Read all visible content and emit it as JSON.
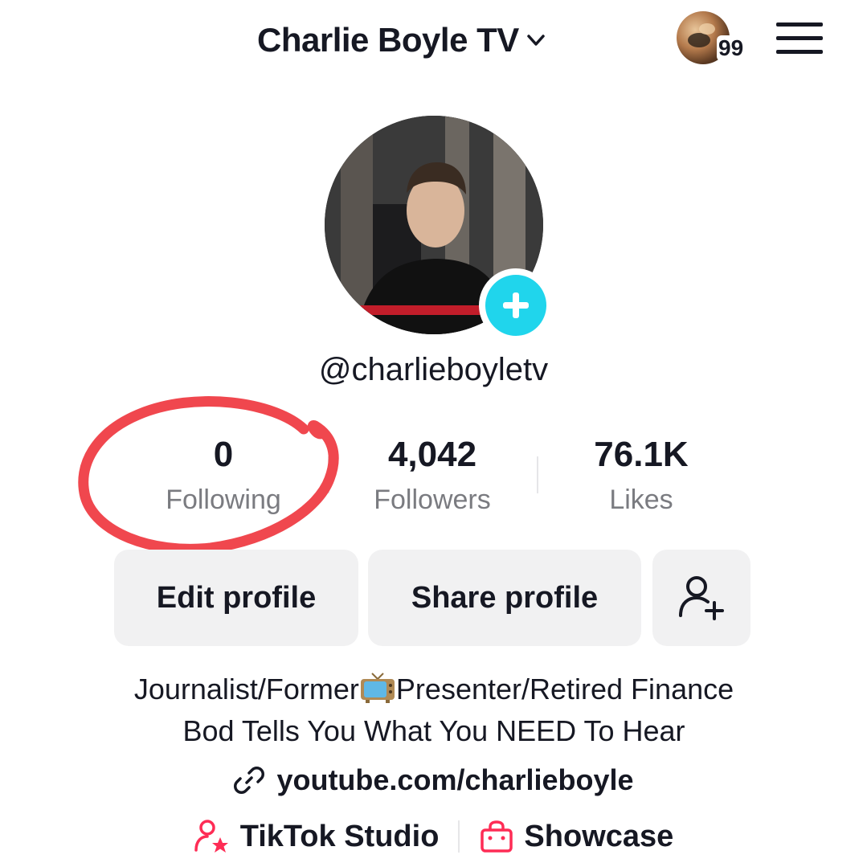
{
  "header": {
    "account_name": "Charlie Boyle TV",
    "notification_count": "99"
  },
  "profile": {
    "username": "@charlieboyletv"
  },
  "stats": [
    {
      "value": "0",
      "label": "Following"
    },
    {
      "value": "4,042",
      "label": "Followers"
    },
    {
      "value": "76.1K",
      "label": "Likes"
    }
  ],
  "actions": {
    "edit_label": "Edit profile",
    "share_label": "Share profile",
    "add_friends_icon": "add-person-icon"
  },
  "bio": {
    "line1_before": "Journalist/Former",
    "line1_emoji": "tv-icon",
    "line1_after": "Presenter/Retired Finance",
    "line2": "Bod Tells You What You NEED To Hear"
  },
  "link": {
    "url": "youtube.com/charlieboyle",
    "icon": "link-icon"
  },
  "footer": {
    "studio_label": "TikTok Studio",
    "showcase_label": "Showcase",
    "accent_color": "#fe2c55"
  },
  "colors": {
    "follow_badge": "#20d5ec",
    "annotation_circle": "#f0474e"
  }
}
